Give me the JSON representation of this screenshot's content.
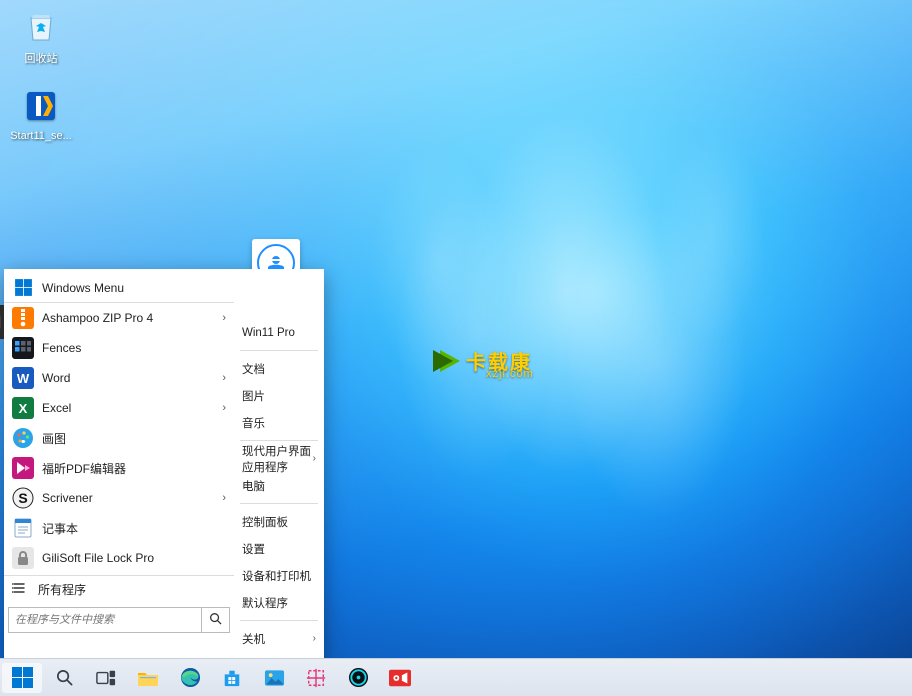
{
  "desktop_icons": {
    "recycle": "回收站",
    "start11": "Start11_se..."
  },
  "watermark": {
    "brand": "卡载康",
    "url": "xzji.com"
  },
  "start_menu": {
    "header": "Windows Menu",
    "apps": [
      {
        "label": "Ashampoo ZIP Pro 4",
        "submenu": true,
        "icon": "zip"
      },
      {
        "label": "Fences",
        "submenu": false,
        "icon": "fences"
      },
      {
        "label": "Word",
        "submenu": true,
        "icon": "word"
      },
      {
        "label": "Excel",
        "submenu": true,
        "icon": "excel"
      },
      {
        "label": "画图",
        "submenu": false,
        "icon": "paint"
      },
      {
        "label": "福昕PDF编辑器",
        "submenu": false,
        "icon": "foxit"
      },
      {
        "label": "Scrivener",
        "submenu": true,
        "icon": "scrivener"
      },
      {
        "label": "记事本",
        "submenu": false,
        "icon": "notepad"
      },
      {
        "label": "GiliSoft File Lock Pro",
        "submenu": false,
        "icon": "lock"
      }
    ],
    "all_programs": "所有程序",
    "search_placeholder": "在程序与文件中搜索",
    "right": {
      "user": "Win11 Pro",
      "links_top": [
        "文档",
        "图片",
        "音乐"
      ],
      "modern_apps": "现代用户界面应用程序",
      "computer": "电脑",
      "links_mid": [
        "控制面板",
        "设置",
        "设备和打印机",
        "默认程序"
      ],
      "power": "关机"
    }
  },
  "taskbar": {
    "items": [
      "start",
      "search",
      "taskview",
      "explorer",
      "edge",
      "store",
      "gallery",
      "snip",
      "groove",
      "recorder"
    ]
  }
}
